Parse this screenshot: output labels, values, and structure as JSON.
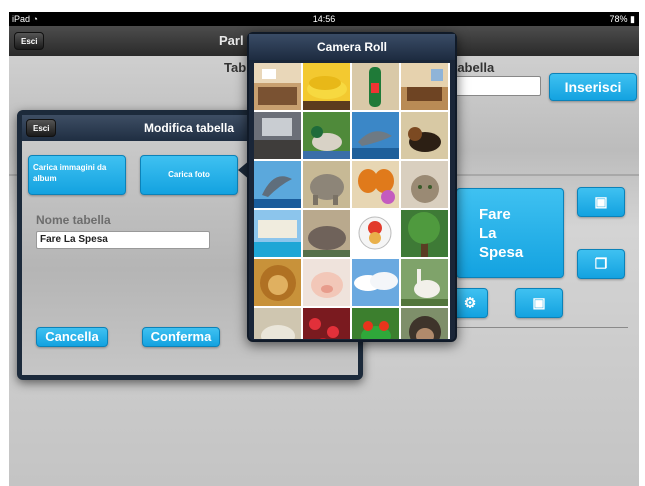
{
  "status_bar": {
    "device": "iPad",
    "wifi_icon": "wifi-icon",
    "time": "14:56",
    "battery": "78%"
  },
  "nav_bar": {
    "back_label": "Esci",
    "title": "Parl"
  },
  "background": {
    "tab_label_partial": "Tab",
    "tabella_label_partial": "tabella",
    "inserisci_label": "Inserisci",
    "card": {
      "line1": "Fare",
      "line2": "La",
      "line3": "Spesa"
    },
    "icons": [
      "contact-icon",
      "copy-icon",
      "contact-icon",
      "gear-icon"
    ]
  },
  "edit_popover": {
    "title": "Modifica tabella",
    "back_label": "Esci",
    "load_album_label": "Carica immagini da album",
    "load_photo_label": "Carica foto",
    "name_label": "Nome tabella",
    "name_value": "Fare La Spesa",
    "cancel_label": "Cancella",
    "confirm_label": "Conferma"
  },
  "camera_roll": {
    "title": "Camera Roll",
    "photos": [
      "kitchen",
      "bananas",
      "bottle",
      "room",
      "room-interior",
      "duck",
      "dolphin",
      "dog",
      "dolphin-jumping",
      "elephant",
      "butterfly",
      "cat",
      "hotel-pool",
      "hippo",
      "clown-logo",
      "tree",
      "lion",
      "pig",
      "clouds",
      "goose",
      "animal",
      "flowers",
      "frog",
      "monkey"
    ]
  },
  "colors": {
    "accent_blue": "#13a2e0",
    "popover_dark": "#1c2a3b",
    "navbar": "#2a2a2a"
  }
}
